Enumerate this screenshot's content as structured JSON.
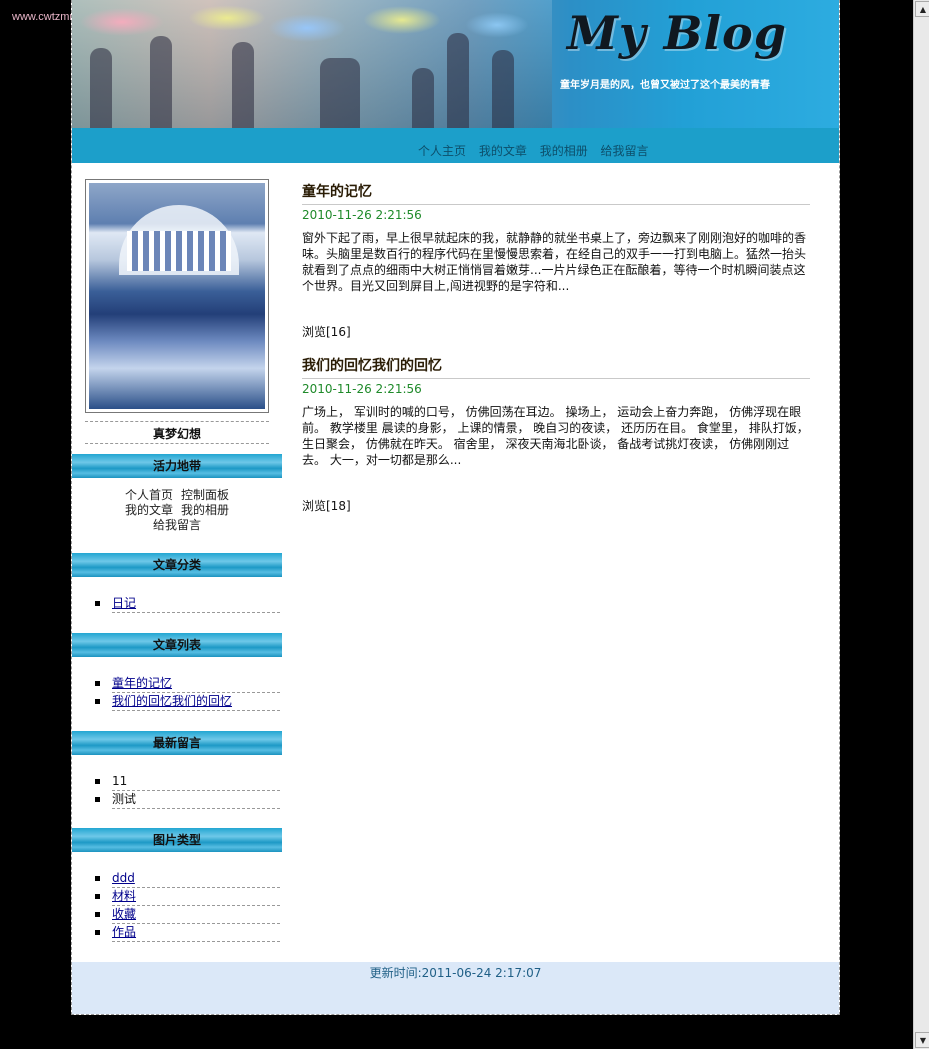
{
  "watermark": "www.cwtzmm",
  "header": {
    "title": "My Blog",
    "subtitle": "童年岁月是的风，也曾又被过了这个最美的青春"
  },
  "nav": [
    "个人主页",
    "我的文章",
    "我的相册",
    "给我留言"
  ],
  "sidebar": {
    "caption": "真梦幻想",
    "sections": {
      "activity": "活力地带",
      "categories": "文章分类",
      "articles": "文章列表",
      "comments": "最新留言",
      "photos": "图片类型"
    },
    "activity_links": {
      "row1": [
        "个人首页",
        "控制面板"
      ],
      "row2": [
        "我的文章",
        "我的相册"
      ],
      "row3": "给我留言"
    },
    "categories": [
      "日记"
    ],
    "articles": [
      "童年的记忆",
      "我们的回忆我们的回忆"
    ],
    "comments": [
      "11",
      "测试"
    ],
    "photo_types": [
      "ddd",
      "材料",
      "收藏",
      "作品"
    ]
  },
  "posts": [
    {
      "title": "童年的记忆",
      "date": "2010-11-26 2:21:56",
      "body": "窗外下起了雨，早上很早就起床的我，就静静的就坐书桌上了，旁边飘来了刚刚泡好的咖啡的香味。头脑里是数百行的程序代码在里慢慢思索着，在经自己的双手一一打到电脑上。猛然一抬头就看到了点点的细雨中大树正悄悄冒着嫩芽...一片片绿色正在酝酿着，等待一个时机瞬间装点这个世界。目光又回到屏目上,闯进视野的是字符和...",
      "views": "浏览[16]"
    },
    {
      "title": "我们的回忆我们的回忆",
      "date": "2010-11-26 2:21:56",
      "body": "广场上， 军训时的喊的口号， 仿佛回荡在耳边。 操场上， 运动会上奋力奔跑， 仿佛浮现在眼前。 教学楼里 晨读的身影， 上课的情景， 晚自习的夜读， 还历历在目。 食堂里， 排队打饭， 生日聚会， 仿佛就在昨天。 宿舍里， 深夜天南海北卧谈， 备战考试挑灯夜读， 仿佛刚刚过去。 大一，对一切都是那么...",
      "views": "浏览[18]"
    }
  ],
  "footer": "更新时间:2011-06-24 2:17:07"
}
